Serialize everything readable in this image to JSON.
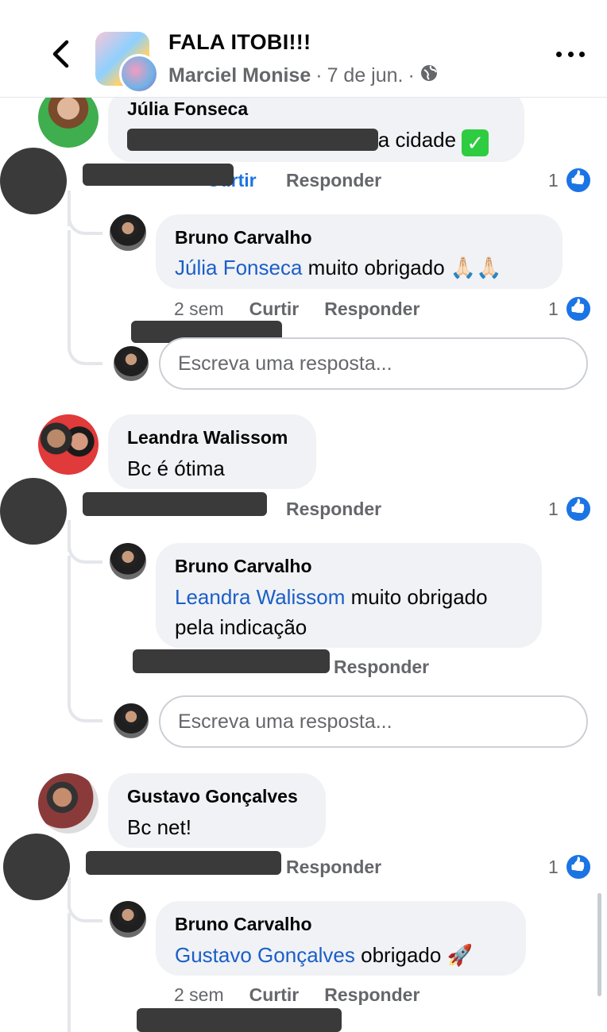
{
  "header": {
    "title": "FALA ITOBI!!!",
    "author": "Marciel Monise",
    "date": "7 de jun.",
    "separator": "·",
    "privacy_icon": "globe-icon"
  },
  "reply_placeholder": "Escreva uma resposta...",
  "comments": [
    {
      "name": "Júlia Fonseca",
      "text_visible": "la cidade",
      "emoji": "✓",
      "actions": {
        "curtir": "Curtir",
        "responder": "Responder"
      },
      "likes": "1",
      "reply": {
        "name": "Bruno Carvalho",
        "mention": "Júlia Fonseca",
        "text": "muito obrigado",
        "emoji": "🙏🏻🙏🏻",
        "time": "2 sem",
        "curtir": "Curtir",
        "responder": "Responder",
        "likes": "1"
      }
    },
    {
      "name": "Leandra Walissom",
      "text": "Bc é ótima",
      "actions": {
        "responder": "Responder"
      },
      "likes": "1",
      "reply": {
        "name": "Bruno Carvalho",
        "mention": "Leandra Walissom",
        "text_line1": "muito obrigado",
        "text_line2": "pela indicação",
        "responder": "Responder"
      }
    },
    {
      "name": "Gustavo Gonçalves",
      "text": "Bc net!",
      "actions": {
        "responder": "Responder"
      },
      "likes": "1",
      "reply": {
        "name": "Bruno Carvalho",
        "mention": "Gustavo Gonçalves",
        "text": "obrigado",
        "emoji": "🚀",
        "time": "2 sem",
        "curtir": "Curtir",
        "responder": "Responder"
      }
    }
  ]
}
